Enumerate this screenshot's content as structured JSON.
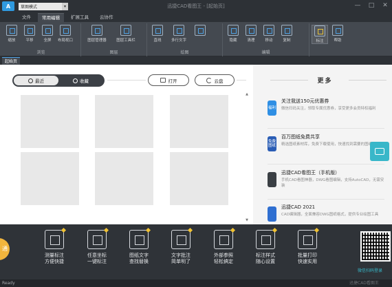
{
  "title_bar": {
    "logo_text": "A",
    "mode": "草图模式",
    "title": "迅捷CAD看图王 - [起始页]",
    "buttons": [
      "—",
      "□",
      "✕"
    ]
  },
  "menu_tabs": [
    "文件",
    "常用编辑",
    "扩展工具",
    "云协作"
  ],
  "active_menu_tab": "常用编辑",
  "ribbon_groups": [
    {
      "label": "浏览",
      "buttons": [
        "缩放",
        "平移",
        "全屏",
        "布局视口"
      ]
    },
    {
      "label": "图层",
      "buttons": [
        "图层管理器",
        "图层工具栏"
      ]
    },
    {
      "label": "绘图",
      "buttons": [
        "直线",
        "多行文字",
        "",
        ""
      ]
    },
    {
      "label": "编辑",
      "buttons": [
        "隐藏",
        "清理",
        "移动",
        "复制"
      ]
    },
    {
      "label": "",
      "buttons": [
        "标注",
        "帮助"
      ]
    }
  ],
  "doc_tab": "起始页",
  "recent_toggle": {
    "recent": "最近",
    "collect": "收藏"
  },
  "open_button": "打开",
  "cloud_button": "云盘",
  "more": {
    "title": "更多",
    "items": [
      {
        "icon_text": "福利",
        "icon_color": "#2f8fe4",
        "title": "关注我送150元优惠券",
        "desc": "微信扫码关注，领取专属优惠券，享受更多会员特权福利"
      },
      {
        "icon_text": "免费图纸",
        "icon_color": "#2a5db5",
        "title": "百万图纸免费共享",
        "desc": "精选图纸素材库，免费下载使用，快速找到需要的图纸"
      },
      {
        "icon_text": "",
        "icon_color": "#3a3f44",
        "title": "迅捷CAD看图王（手机版）",
        "desc": "手机CAD看图神器，DWG看图编辑，支持AutoCAD，无需安装"
      },
      {
        "icon_text": "",
        "icon_color": "#2f6fd1",
        "title": "迅捷CAD 2021",
        "desc": "CAD编辑器，全面兼容DWG图纸格式，提供专业绘图工具"
      }
    ]
  },
  "features": [
    {
      "line1": "测量标注",
      "line2": "方便快捷"
    },
    {
      "line1": "任意坐标",
      "line2": "一键标注"
    },
    {
      "line1": "图纸文字",
      "line2": "查找替换"
    },
    {
      "line1": "文字批注",
      "line2": "简单明了"
    },
    {
      "line1": "外部参照",
      "line2": "轻松搞定"
    },
    {
      "line1": "标注样式",
      "line2": "随心设置"
    },
    {
      "line1": "批量打印",
      "line2": "快速实用"
    }
  ],
  "kaitong_label": "通",
  "qr_label": "微信扫码登录",
  "status": {
    "left": "Ready",
    "right": "迅捷CAD看图王"
  }
}
